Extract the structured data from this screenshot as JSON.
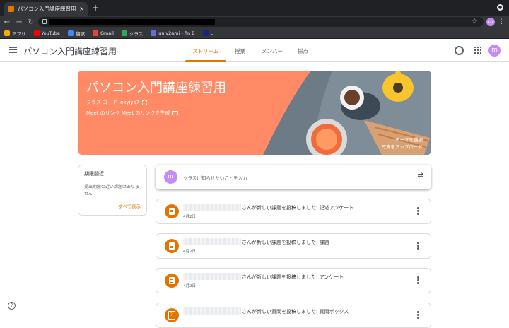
{
  "browser": {
    "tab_title": "パソコン入門講座練習用",
    "tab_close": "×",
    "new_tab": "+",
    "profile_initial": "m",
    "bookmarks": [
      {
        "label": "アプリ",
        "color": "#f9ab00"
      },
      {
        "label": "YouTube",
        "color": "#ff0000"
      },
      {
        "label": "翻訳",
        "color": "#4285f4"
      },
      {
        "label": "Gmail",
        "color": "#ea4335"
      },
      {
        "label": "クラス",
        "color": "#34a853"
      },
      {
        "label": "univ2ami - fin B",
        "color": "#5f6fd6"
      },
      {
        "label": "L",
        "color": "#1a237e"
      }
    ]
  },
  "header": {
    "title": "パソコン入門講座練習用",
    "tabs": [
      "ストリーム",
      "授業",
      "メンバー",
      "採点"
    ],
    "avatar_initial": "m"
  },
  "banner": {
    "title": "パソコン入門講座練習用",
    "class_code_label": "クラス コード",
    "class_code": "nkyiya7",
    "meet_text": "Meet のリンク  Meet のリンクを生成",
    "theme_link": "テーマを選択",
    "upload_link": "写真をアップロード"
  },
  "upcoming": {
    "title": "期限間近",
    "text": "提出期限の近い課題はありません",
    "link": "すべて表示"
  },
  "announce": {
    "avatar_initial": "m",
    "placeholder": "クラスに知らせたいことを入力"
  },
  "posts": [
    {
      "title": "さんが新しい課題を投稿しました: 記述アンケート",
      "date": "4月2日",
      "kind": "assignment"
    },
    {
      "title": "さんが新しい課題を投稿しました: 課題",
      "date": "4月2日",
      "kind": "assignment"
    },
    {
      "title": "さんが新しい課題を投稿しました: アンケート",
      "date": "4月2日",
      "kind": "assignment"
    },
    {
      "title": "さんが新しい質問を投稿しました: 質問ボックス",
      "date": "",
      "kind": "question"
    }
  ],
  "colors": {
    "accent": "#e37400",
    "banner": "#ff8a65",
    "avatar": "#c58af9"
  }
}
